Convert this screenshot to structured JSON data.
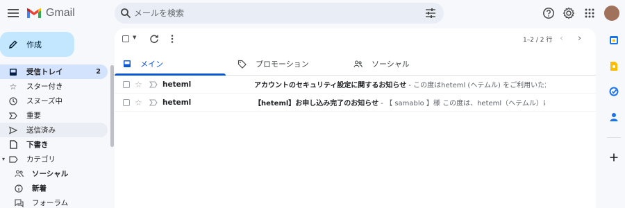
{
  "header": {
    "app_name": "Gmail",
    "search_placeholder": "メールを検索"
  },
  "sidebar": {
    "compose_label": "作成",
    "items": [
      {
        "label": "受信トレイ",
        "count": "2"
      },
      {
        "label": "スター付き"
      },
      {
        "label": "スヌーズ中"
      },
      {
        "label": "重要"
      },
      {
        "label": "送信済み"
      },
      {
        "label": "下書き"
      },
      {
        "label": "カテゴリ"
      },
      {
        "label": "ソーシャル"
      },
      {
        "label": "新着"
      },
      {
        "label": "フォーラム"
      }
    ]
  },
  "toolbar": {
    "pagination": "1–2 / 2 行"
  },
  "tabs": [
    {
      "label": "メイン"
    },
    {
      "label": "プロモーション"
    },
    {
      "label": "ソーシャル"
    }
  ],
  "emails": [
    {
      "sender": "heteml",
      "subject": "アカウントのセキュリティ設定に関するお知らせ",
      "separator": " - ",
      "snippet": "この度はheteml (ヘテムル) をご利用いただきあ..."
    },
    {
      "sender": "heteml",
      "subject": "【heteml】お申し込み完了のお知らせ",
      "separator": " - ",
      "snippet": "【 samablo 】様 この度は、heteml（ヘテムル）にお申し..."
    }
  ],
  "colors": {
    "accent": "#0b57d0",
    "compose_bg": "#c2e7ff",
    "active_nav_bg": "#d3e3fd",
    "page_bg": "#f6f8fc"
  }
}
